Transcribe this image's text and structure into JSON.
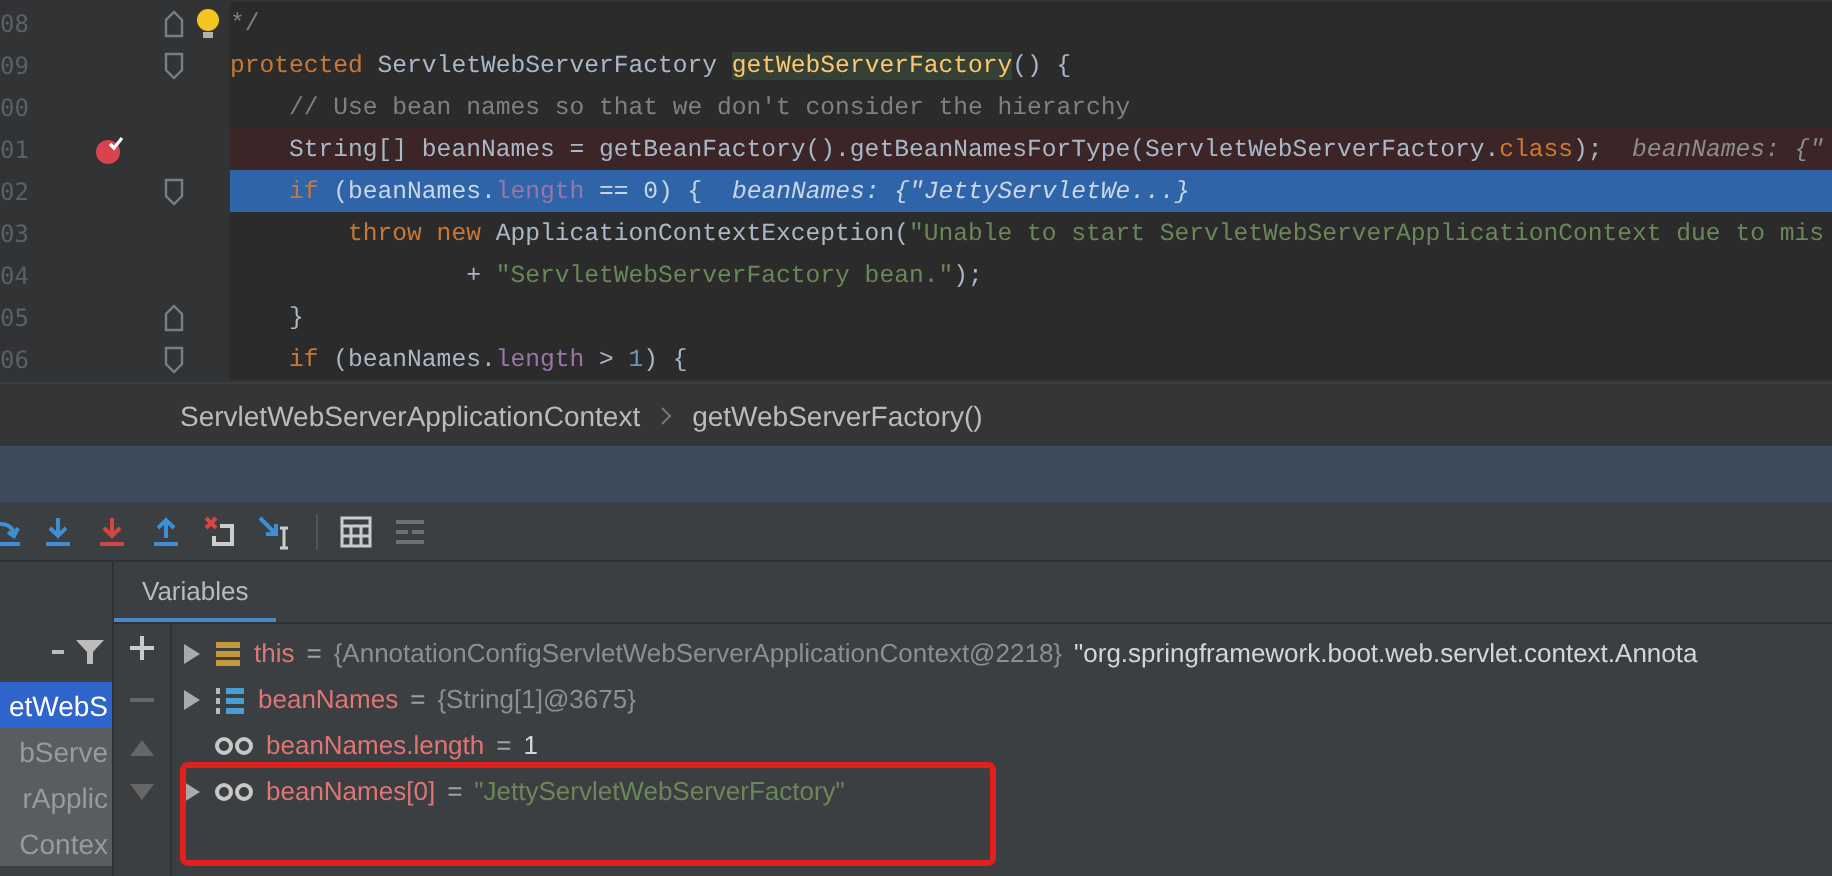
{
  "editor": {
    "lines": [
      {
        "number": "08",
        "kind": "plain",
        "gutter_icons": [
          {
            "kind": "fold-end"
          },
          {
            "kind": "bulb"
          }
        ],
        "tokens": [
          {
            "kind": "comment",
            "text": "*/"
          }
        ]
      },
      {
        "number": "09",
        "kind": "plain",
        "gutter_icons": [
          {
            "kind": "fold-start"
          }
        ],
        "tokens": [
          {
            "kind": "keyword",
            "text": "protected "
          },
          {
            "kind": "plain",
            "text": "ServletWebServerFactory "
          },
          {
            "kind": "method",
            "text": "getWebServerFactory"
          },
          {
            "kind": "plain",
            "text": "() {"
          }
        ]
      },
      {
        "number": "00",
        "kind": "plain",
        "tokens": [
          {
            "kind": "comment",
            "text": "    // Use bean names so that we don't consider the hierarchy"
          }
        ]
      },
      {
        "number": "01",
        "kind": "breakpoint",
        "gutter_icons": [
          {
            "kind": "breakpoint"
          }
        ],
        "tokens": [
          {
            "kind": "plain",
            "text": "    String[] beanNames = getBeanFactory().getBeanNamesForType(ServletWebServerFactory."
          },
          {
            "kind": "keyword",
            "text": "class"
          },
          {
            "kind": "plain",
            "text": ");"
          },
          {
            "kind": "hint",
            "text": "  beanNames: {\""
          }
        ]
      },
      {
        "number": "02",
        "kind": "current",
        "gutter_icons": [
          {
            "kind": "fold-start"
          }
        ],
        "tokens": [
          {
            "kind": "keyword",
            "text": "    if "
          },
          {
            "kind": "plain",
            "text": "(beanNames."
          },
          {
            "kind": "field",
            "text": "length"
          },
          {
            "kind": "plain",
            "text": " == "
          },
          {
            "kind": "number",
            "text": "0"
          },
          {
            "kind": "plain",
            "text": ") {"
          },
          {
            "kind": "hint",
            "text": "  beanNames: {\"JettyServletWe...}"
          }
        ]
      },
      {
        "number": "03",
        "kind": "plain",
        "tokens": [
          {
            "kind": "keyword",
            "text": "        throw new "
          },
          {
            "kind": "plain",
            "text": "ApplicationContextException("
          },
          {
            "kind": "string",
            "text": "\"Unable to start ServletWebServerApplicationContext due to mis"
          }
        ]
      },
      {
        "number": "04",
        "kind": "plain",
        "tokens": [
          {
            "kind": "plain",
            "text": "                + "
          },
          {
            "kind": "string",
            "text": "\"ServletWebServerFactory bean.\""
          },
          {
            "kind": "plain",
            "text": ");"
          }
        ]
      },
      {
        "number": "05",
        "kind": "plain",
        "gutter_icons": [
          {
            "kind": "fold-end"
          }
        ],
        "tokens": [
          {
            "kind": "plain",
            "text": "    }"
          }
        ]
      },
      {
        "number": "06",
        "kind": "plain",
        "gutter_icons": [
          {
            "kind": "fold-start"
          }
        ],
        "tokens": [
          {
            "kind": "keyword",
            "text": "    if "
          },
          {
            "kind": "plain",
            "text": "(beanNames."
          },
          {
            "kind": "field",
            "text": "length"
          },
          {
            "kind": "plain",
            "text": " > "
          },
          {
            "kind": "number",
            "text": "1"
          },
          {
            "kind": "plain",
            "text": ") {"
          }
        ]
      }
    ]
  },
  "breadcrumbs": [
    {
      "label": "ServletWebServerApplicationContext"
    },
    {
      "label": "getWebServerFactory()"
    }
  ],
  "toolbar": [
    {
      "kind": "step-over",
      "disabled": false
    },
    {
      "kind": "step-into",
      "disabled": false
    },
    {
      "kind": "force-step-into",
      "disabled": false
    },
    {
      "kind": "step-out",
      "disabled": false
    },
    {
      "kind": "drop-frame",
      "disabled": false
    },
    {
      "kind": "run-to-cursor",
      "disabled": false
    },
    {
      "kind": "evaluate",
      "disabled": false
    },
    {
      "kind": "trace",
      "disabled": true
    }
  ],
  "frames": {
    "items": [
      {
        "label": "etWebS",
        "selected": true
      },
      {
        "label": "bServe",
        "selected": false
      },
      {
        "label": "rApplic",
        "selected": false
      },
      {
        "label": "Contex",
        "selected": false
      }
    ]
  },
  "variables": {
    "tab": {
      "label": "Variables",
      "selected": true
    },
    "rows": [
      {
        "kind": "object",
        "expandable": true,
        "outlined": false,
        "name": "this",
        "sign": "=",
        "values": [
          {
            "kind": "ref",
            "text": "{AnnotationConfigServletWebServerApplicationContext@2218}"
          },
          {
            "kind": "plain",
            "text": "\"org.springframework.boot.web.servlet.context.Annota"
          }
        ]
      },
      {
        "kind": "array",
        "expandable": true,
        "outlined": false,
        "name": "beanNames",
        "sign": "=",
        "values": [
          {
            "kind": "ref",
            "text": "{String[1]@3675}"
          }
        ]
      },
      {
        "kind": "watch",
        "expandable": false,
        "outlined": false,
        "name": "beanNames.length",
        "sign": "=",
        "values": [
          {
            "kind": "plain",
            "text": "1"
          }
        ]
      },
      {
        "kind": "watch",
        "expandable": true,
        "outlined": true,
        "name": "beanNames[0]",
        "sign": "=",
        "values": [
          {
            "kind": "string",
            "text": "\"JettyServletWebServerFactory\""
          }
        ]
      }
    ]
  }
}
